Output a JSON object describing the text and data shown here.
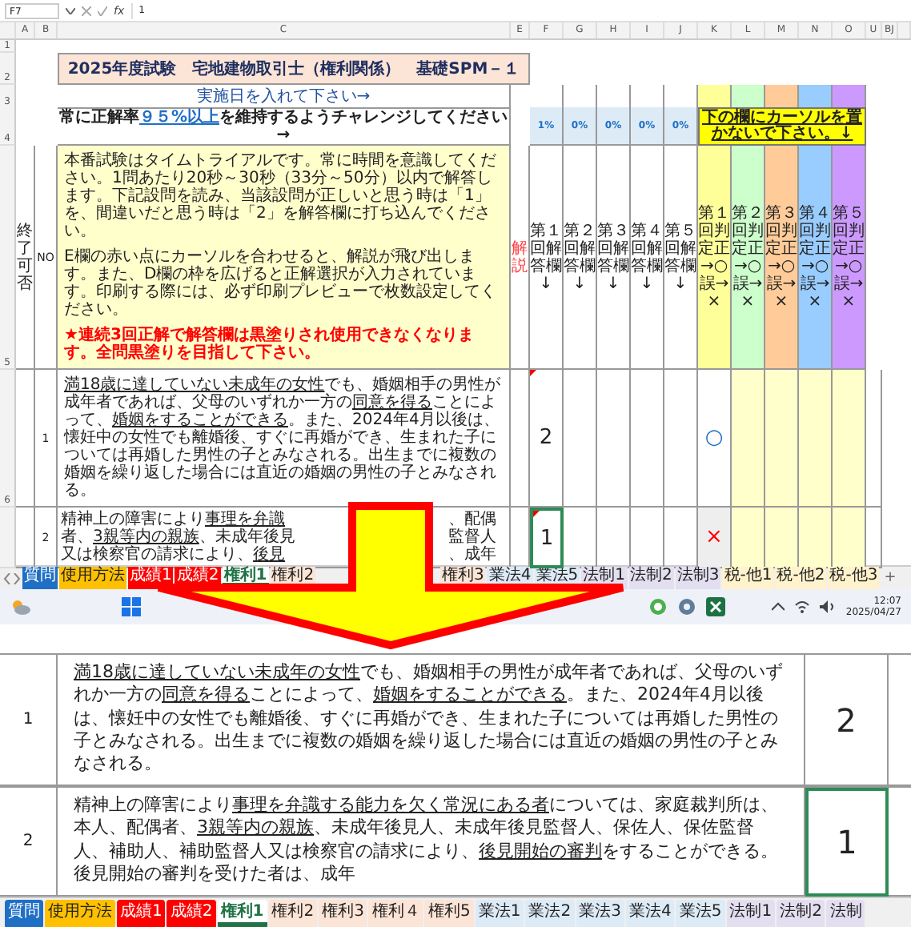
{
  "top_view": {
    "name_box": "F7",
    "fx": "fx",
    "formula": "1",
    "columns": [
      "A",
      "B",
      "C",
      "E",
      "F",
      "G",
      "H",
      "I",
      "J",
      "K",
      "L",
      "M",
      "N",
      "O",
      "U",
      "BJ"
    ],
    "blank_row": {
      "label": "1"
    },
    "title_row": {
      "label": "2",
      "title": "2025年度試験　宅地建物取引士（権利関係）　基礎SPM－１"
    },
    "date_row": {
      "label": "3",
      "text": "実施日を入れて下さい→"
    },
    "goal_row": {
      "label": "4",
      "before": "常に正解率",
      "highlight": "９５%以上",
      "after": "を維持するようチャレンジしてください→",
      "percents": [
        "1%",
        "0%",
        "0%",
        "0%",
        "0%"
      ],
      "warning": "下の欄にカーソルを置かないで下さい。↓"
    },
    "header_row": {
      "label": "5",
      "status_heading": "終了可否",
      "no_heading": "NO",
      "instructions": [
        {
          "kind": "normal",
          "text": "本番試験はタイムトライアルです。常に時間を意識してください。1問あたり20秒～30秒（33分～50分）以内で解答します。下記設問を読み、当該設問が正しいと思う時は「1」を、間違いだと思う時は「2」を解答欄に打ち込んでください。"
        },
        {
          "kind": "normal",
          "text": "E欄の赤い点にカーソルを合わせると、解説が飛び出します。また、D欄の枠を広げると正解選択が入力されています。印刷する際には、必ず印刷プレビューで枚数設定してください。"
        },
        {
          "kind": "alert",
          "text": "★連続3回正解で解答欄は黒塗りされ使用できなくなります。全問黒塗りを目指して下さい。"
        }
      ],
      "commentary": "解説",
      "answer_headings": [
        "第１回解答欄↓",
        "第２回解答欄↓",
        "第３回解答欄↓",
        "第４回解答欄↓",
        "第５回解答欄↓"
      ],
      "judge_headings": [
        {
          "text": "第１回判定正→○誤→×",
          "color": "#ffff99"
        },
        {
          "text": "第２回判定正→○誤→×",
          "color": "#ccffcc"
        },
        {
          "text": "第３回判定正→○誤→×",
          "color": "#ffcc99"
        },
        {
          "text": "第４回判定正→○誤→×",
          "color": "#99ccff"
        },
        {
          "text": "第５回判定正→○誤→×",
          "color": "#cc99ff"
        }
      ]
    },
    "question_1": {
      "label": "6",
      "no": "1",
      "segments": [
        {
          "text": "満18歳に達していない未成年の女性",
          "underline": true
        },
        {
          "text": "でも、婚姻相手の男性が成年者であれば、父母のいずれか一方の",
          "underline": false
        },
        {
          "text": "同意を得る",
          "underline": true
        },
        {
          "text": "ことによって、",
          "underline": false
        },
        {
          "text": "婚姻をすることができる",
          "underline": true
        },
        {
          "text": "。また、2024年4月以後は、懐妊中の女性でも離婚後、すぐに再婚ができ、生まれた子については再婚した男性の子とみなされる。出生までに複数の婚姻を繰り返した場合には直近の婚姻の男性の子とみなされる。",
          "underline": false
        }
      ],
      "answer": {
        "value": "2",
        "selected": false
      },
      "judgement": {
        "mark": "○",
        "kind": "correct"
      }
    },
    "question_2": {
      "no": "2",
      "left_lines": [
        [
          {
            "text": "精神上の障害により",
            "underline": false
          },
          {
            "text": "事理を弁識",
            "underline": true
          }
        ],
        [
          {
            "text": "者、",
            "underline": false
          },
          {
            "text": "3親等内の親族",
            "underline": true
          },
          {
            "text": "、未成年後見",
            "underline": false
          }
        ],
        [
          {
            "text": "又は検察官の請求により、",
            "underline": false
          },
          {
            "text": "後見",
            "underline": true
          }
        ]
      ],
      "right_lines": [
        "、配偶",
        "監督人",
        "、成年"
      ],
      "answer": {
        "value": "1",
        "selected": true
      },
      "judgement": {
        "mark": "×",
        "kind": "wrong"
      }
    },
    "sheet_tabs_before_arrow": [
      {
        "label": "質問",
        "color": "#1f6fc5",
        "selected": false
      },
      {
        "label": "使用方法",
        "color": "#ffc000",
        "selected": false
      },
      {
        "label": "成績1",
        "color": "#ff0000",
        "selected": false
      },
      {
        "label": "成績2",
        "color": "#ff0000",
        "selected": false
      },
      {
        "label": "権利1",
        "color": "#ffffff",
        "selected": true
      },
      {
        "label": "権利2",
        "color": "#fce4d6",
        "selected": false
      }
    ],
    "sheet_tabs_after_arrow": [
      {
        "label": "権利3",
        "color": "#fce4d6",
        "selected": false
      },
      {
        "label": "業法4",
        "color": "#ddebf7",
        "selected": false
      },
      {
        "label": "業法5",
        "color": "#ddebf7",
        "selected": false
      },
      {
        "label": "法制1",
        "color": "#e4dff0",
        "selected": false
      },
      {
        "label": "法制2",
        "color": "#e4dff0",
        "selected": false
      },
      {
        "label": "法制3",
        "color": "#e4dff0",
        "selected": false
      },
      {
        "label": "税-他1",
        "color": "#fff2cc",
        "selected": false
      },
      {
        "label": "税-他2",
        "color": "#fff2cc",
        "selected": false
      },
      {
        "label": "税-他3",
        "color": "#fff2cc",
        "selected": false
      }
    ],
    "add_sheet": "+",
    "taskbar": {
      "time": "12:07",
      "date": "2025/04/27"
    }
  },
  "zoom_view": {
    "rows": [
      {
        "no": "1",
        "segments": [
          {
            "text": "満18歳に達していない未成年の女性",
            "underline": true
          },
          {
            "text": "でも、婚姻相手の男性が成年者であれば、父母のいずれか一方の",
            "underline": false
          },
          {
            "text": "同意を得る",
            "underline": true
          },
          {
            "text": "ことによって、",
            "underline": false
          },
          {
            "text": "婚姻をすることができる",
            "underline": true
          },
          {
            "text": "。また、2024年4月以後は、懐妊中の女性でも離婚後、すぐに再婚ができ、生まれた子については再婚した男性の子とみなされる。出生までに複数の婚姻を繰り返した場合には直近の婚姻の男性の子とみなされる。",
            "underline": false
          }
        ],
        "answer": {
          "value": "2",
          "selected": false
        }
      },
      {
        "no": "2",
        "segments": [
          {
            "text": "精神上の障害により",
            "underline": false
          },
          {
            "text": "事理を弁識する能力を欠く常況にある者",
            "underline": true
          },
          {
            "text": "については、家庭裁判所は、本人、配偶者、",
            "underline": false
          },
          {
            "text": "3親等内の親族",
            "underline": true
          },
          {
            "text": "、未成年後見人、未成年後見監督人、保佐人、保佐監督人、補助人、補助監督人又は検察官の請求により、",
            "underline": false
          },
          {
            "text": "後見開始の審判",
            "underline": true
          },
          {
            "text": "をすることができる。後見開始の審判を受けた者は、成年",
            "underline": false
          }
        ],
        "answer": {
          "value": "1",
          "selected": true
        }
      }
    ],
    "sheet_tabs": [
      {
        "label": "質問",
        "color": "#1f6fc5",
        "selected": false
      },
      {
        "label": "使用方法",
        "color": "#ffc000",
        "selected": false
      },
      {
        "label": "成績1",
        "color": "#ff0000",
        "selected": false
      },
      {
        "label": "成績2",
        "color": "#ff0000",
        "selected": false
      },
      {
        "label": "権利1",
        "color": "#ffffff",
        "selected": true
      },
      {
        "label": "権利2",
        "color": "#fce4d6",
        "selected": false
      },
      {
        "label": "権利3",
        "color": "#fce4d6",
        "selected": false
      },
      {
        "label": "権利４",
        "color": "#fce4d6",
        "selected": false
      },
      {
        "label": "権利5",
        "color": "#fce4d6",
        "selected": false
      },
      {
        "label": "業法1",
        "color": "#ddebf7",
        "selected": false
      },
      {
        "label": "業法2",
        "color": "#ddebf7",
        "selected": false
      },
      {
        "label": "業法3",
        "color": "#ddebf7",
        "selected": false
      },
      {
        "label": "業法4",
        "color": "#ddebf7",
        "selected": false
      },
      {
        "label": "業法5",
        "color": "#ddebf7",
        "selected": false
      },
      {
        "label": "法制1",
        "color": "#e4dff0",
        "selected": false
      },
      {
        "label": "法制2",
        "color": "#e4dff0",
        "selected": false
      },
      {
        "label": "法制",
        "color": "#e4dff0",
        "selected": false
      }
    ]
  }
}
